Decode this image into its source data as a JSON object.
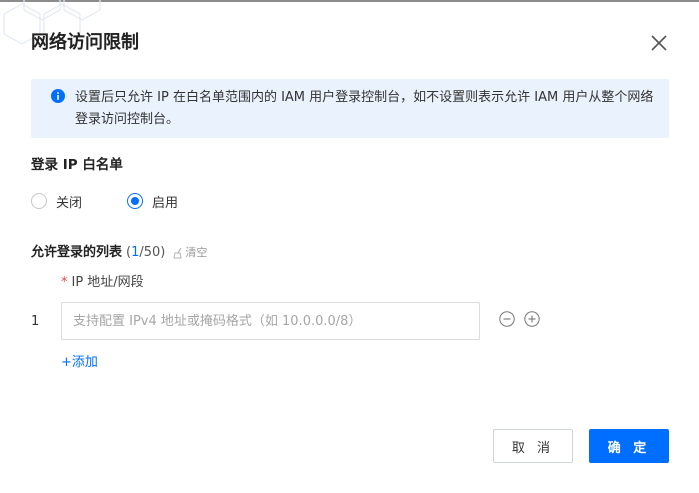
{
  "dialog": {
    "title": "网络访问限制",
    "close_icon": "close-icon"
  },
  "notice": {
    "icon": "info-icon",
    "text": "设置后只允许 IP 在白名单范围内的 IAM 用户登录控制台，如不设置则表示允许 IAM 用户从整个网络登录访问控制台。"
  },
  "whitelist": {
    "label": "登录 IP 白名单",
    "options": [
      {
        "label": "关闭",
        "checked": false
      },
      {
        "label": "启用",
        "checked": true
      }
    ]
  },
  "allow_list": {
    "label": "允许登录的列表",
    "count_open": "(",
    "count_current": "1",
    "count_total": "/50)",
    "clear_label": "清空",
    "field_required_mark": "*",
    "field_label": "IP 地址/网段",
    "rows": [
      {
        "index": "1",
        "value": "",
        "placeholder": "支持配置 IPv4 地址或掩码格式（如 10.0.0.0/8）"
      }
    ],
    "add_label": "+添加"
  },
  "footer": {
    "cancel_label": "取 消",
    "ok_label": "确 定"
  },
  "colors": {
    "primary": "#006eff",
    "notice_bg": "#eaf2fd",
    "required": "#e54545"
  }
}
